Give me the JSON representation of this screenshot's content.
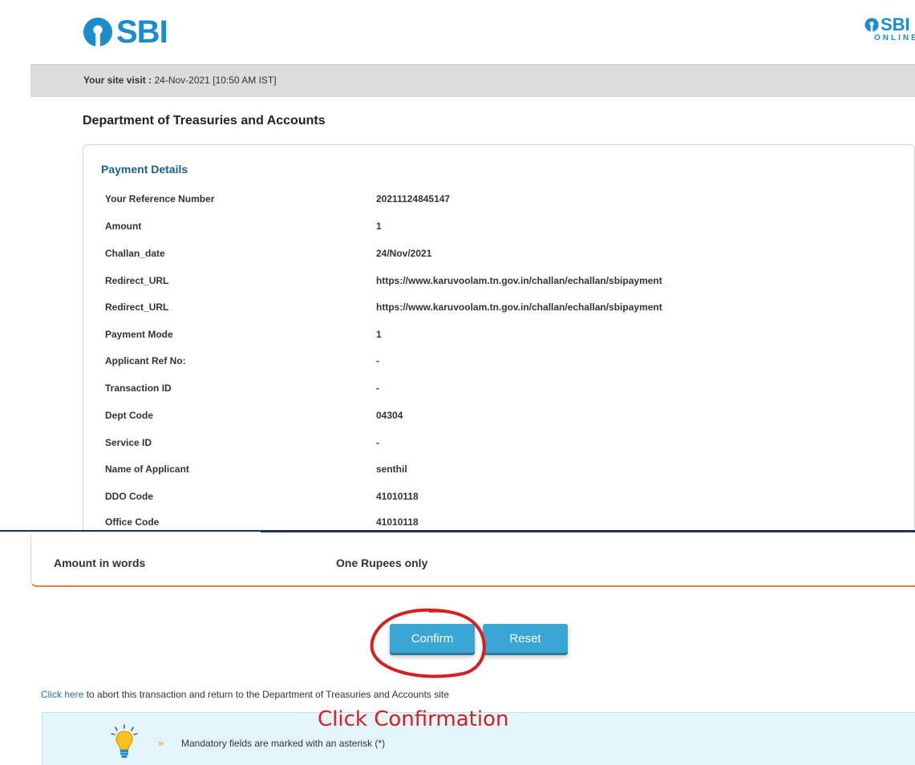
{
  "header": {
    "brand": "SBI",
    "brand_right": "SBI",
    "brand_right_sub": "ONLINE"
  },
  "visit": {
    "label": "Your site visit :",
    "value": "24-Nov-2021 [10:50 AM IST]"
  },
  "department_title": "Department of Treasuries and Accounts",
  "payment_details": {
    "heading": "Payment Details",
    "rows": [
      {
        "label": "Your Reference Number",
        "value": "20211124845147"
      },
      {
        "label": "Amount",
        "value": "1"
      },
      {
        "label": "Challan_date",
        "value": "24/Nov/2021"
      },
      {
        "label": "Redirect_URL",
        "value": "https://www.karuvoolam.tn.gov.in/challan/echallan/sbipayment"
      },
      {
        "label": "Redirect_URL",
        "value": "https://www.karuvoolam.tn.gov.in/challan/echallan/sbipayment"
      },
      {
        "label": "Payment Mode",
        "value": "1"
      },
      {
        "label": "Applicant Ref No:",
        "value": "-"
      },
      {
        "label": "Transaction ID",
        "value": "-"
      },
      {
        "label": "Dept Code",
        "value": "04304"
      },
      {
        "label": "Service ID",
        "value": "-"
      },
      {
        "label": "Name of Applicant",
        "value": "senthil"
      },
      {
        "label": "DDO Code",
        "value": "41010118"
      },
      {
        "label": "Office Code",
        "value": "41010118"
      }
    ],
    "cut_row": {
      "label": "Amount in words",
      "value": "One Rupees only"
    }
  },
  "buttons": {
    "confirm": "Confirm",
    "reset": "Reset"
  },
  "abort": {
    "link": "Click here",
    "text": " to abort this transaction and return to the Department of Treasuries and Accounts site"
  },
  "annotation": {
    "text": "Click Confirmation",
    "color": "#d62020"
  },
  "info": {
    "chevron": "»",
    "text": "Mandatory fields are marked with an asterisk (*)"
  },
  "colors": {
    "brand": "#1d8ccd",
    "button": "#3aa6d6",
    "heading": "#1c5f8f",
    "card_border_bottom": "#e37a4b"
  }
}
